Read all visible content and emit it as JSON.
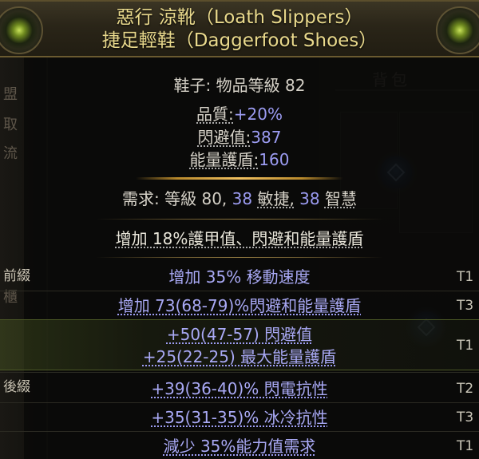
{
  "item": {
    "name": "惡行 涼靴（Loath Slippers）",
    "base": "捷足輕鞋（Daggerfoot Shoes）",
    "type_prefix": "鞋子:",
    "type_rest": "物品等級 82",
    "quality_label": "品質:",
    "quality_value": "+20%",
    "evasion_label": "閃避值:",
    "evasion_value": "387",
    "es_label": "能量護盾:",
    "es_value": "160",
    "req_label": "需求:",
    "req_level": "等級 80,",
    "req_dex_value": "38",
    "req_dex_label": "敏捷,",
    "req_int_value": "38",
    "req_int_label": "智慧",
    "implicit": "增加 18%護甲值、閃避和能量護盾"
  },
  "labels": {
    "prefix": "前綴",
    "suffix": "後綴"
  },
  "mods": [
    {
      "text": "增加 35% 移動速度",
      "tier": "T1"
    },
    {
      "text": "增加 73(68-79)%閃避和能量護盾",
      "tier": "T3"
    },
    {
      "text": "+50(47-57) 閃避值",
      "tier": "T1"
    },
    {
      "text": "+25(22-25) 最大能量護盾",
      "tier": ""
    },
    {
      "text": "+39(36-40)% 閃電抗性",
      "tier": "T2"
    },
    {
      "text": "+35(31-35)% 冰冷抗性",
      "tier": "T3"
    },
    {
      "text": "減少 35%能力值需求",
      "tier": "T1"
    }
  ],
  "background": {
    "bag_title": "背包",
    "left_chars": [
      "盟",
      "取",
      "流",
      "櫃"
    ]
  },
  "colors": {
    "title": "#e9d98c",
    "mod": "#a9a9f5",
    "value": "#9c9cf2",
    "separator": "#f0c060"
  }
}
